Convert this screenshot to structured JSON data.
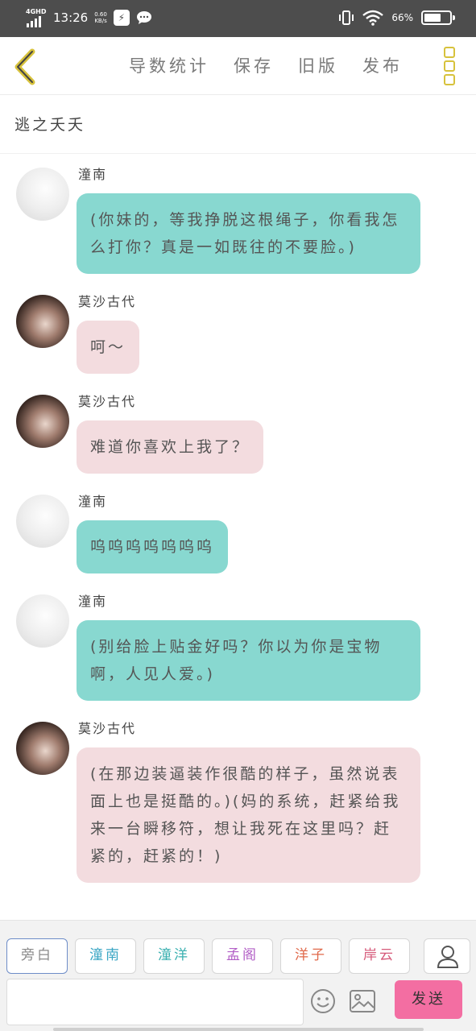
{
  "status_bar": {
    "network": "4GHD",
    "time": "13:26",
    "speed_value": "0.60",
    "speed_unit": "KB/s",
    "battery": "66%",
    "battery_level": 0.66,
    "icons": [
      "signal-icon",
      "lightning-app-icon",
      "chat-bubble-icon",
      "vibrate-icon",
      "wifi-icon",
      "battery-icon"
    ]
  },
  "header": {
    "menu": [
      "导数统计",
      "保存",
      "旧版",
      "发布"
    ],
    "icons": {
      "back": "chevron-left-icon",
      "more": "more-vertical-icon"
    },
    "accent_color": "#d7c23c"
  },
  "story": {
    "title": "逃之夭夭"
  },
  "messages": [
    {
      "sender": "潼南",
      "text": "(你妹的，等我挣脱这根绳子，你看我怎么打你？真是一如既往的不要脸。)",
      "style": "teal",
      "avatar": "avatar-light"
    },
    {
      "sender": "莫沙古代",
      "text": "呵～",
      "style": "pink",
      "avatar": "avatar-dark"
    },
    {
      "sender": "莫沙古代",
      "text": "难道你喜欢上我了？",
      "style": "pink",
      "avatar": "avatar-dark"
    },
    {
      "sender": "潼南",
      "text": "呜呜呜呜呜呜呜",
      "style": "teal",
      "avatar": "avatar-light"
    },
    {
      "sender": "潼南",
      "text": "(别给脸上贴金好吗？你以为你是宝物啊，人见人爱。)",
      "style": "teal",
      "avatar": "avatar-light"
    },
    {
      "sender": "莫沙古代",
      "text": "(在那边装逼装作很酷的样子，虽然说表面上也是挺酷的。)(妈的系统，赶紧给我来一台瞬移符，想让我死在这里吗？赶紧的，赶紧的！)",
      "style": "pink",
      "avatar": "avatar-dark"
    }
  ],
  "colors": {
    "teal_bubble": "#88d8d0",
    "pink_bubble": "#f3dcdf",
    "send_button": "#f36ea2"
  },
  "roles": [
    {
      "label": "旁白",
      "color": "#8a8a8a",
      "active": true
    },
    {
      "label": "潼南",
      "color": "#3aa6c4",
      "active": false
    },
    {
      "label": "潼洋",
      "color": "#3ab0b0",
      "active": false
    },
    {
      "label": "孟阁",
      "color": "#b25ec6",
      "active": false
    },
    {
      "label": "洋子",
      "color": "#e0694a",
      "active": false
    },
    {
      "label": "岸云",
      "color": "#d65a7a",
      "active": false
    }
  ],
  "input": {
    "placeholder": "",
    "send_label": "发送"
  }
}
